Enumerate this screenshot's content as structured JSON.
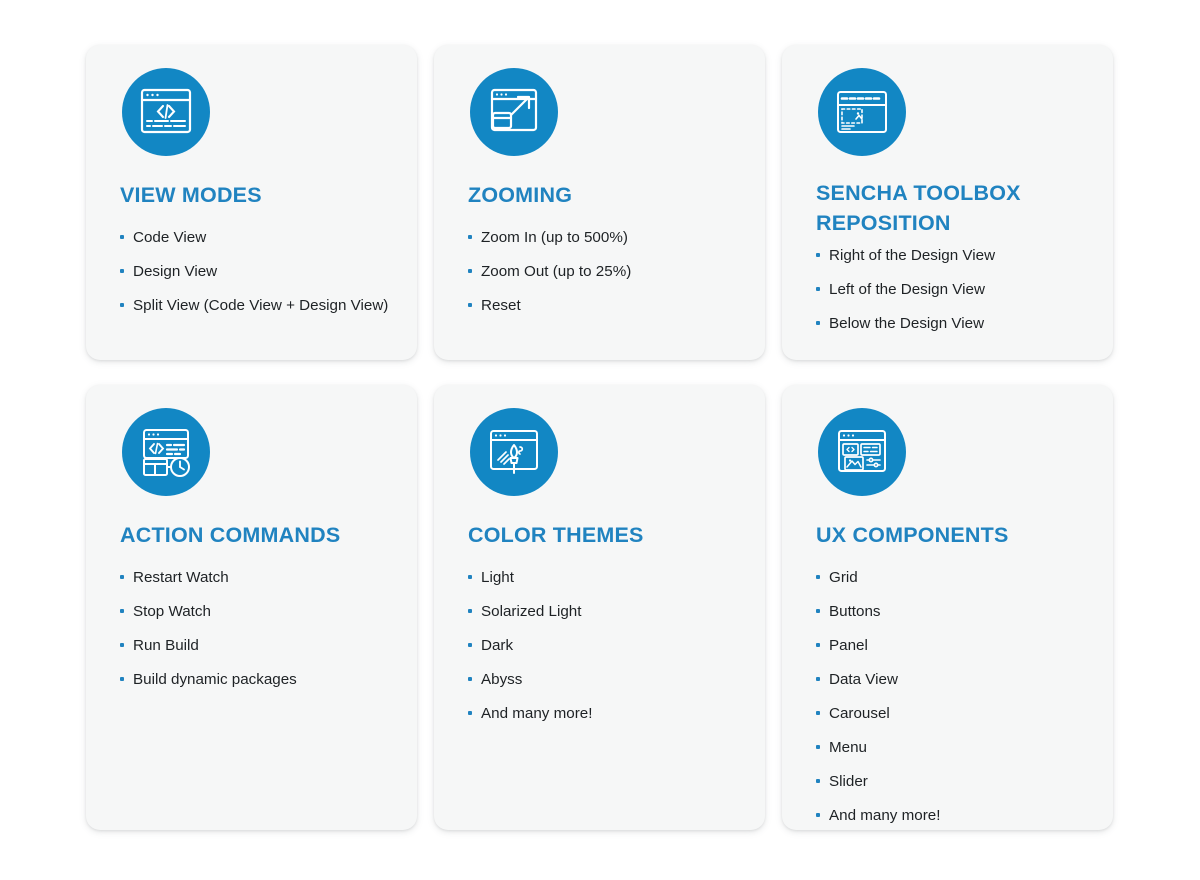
{
  "theme": {
    "page_background": "#ffffff",
    "card_background": "#f6f7f7",
    "icon_circle_color": "#1287c4",
    "title_color": "#2083c0",
    "bullet_color": "#2083c0",
    "body_text_color": "#1e2225"
  },
  "cards": [
    {
      "icon": "code-window-icon",
      "title": "VIEW MODES",
      "items": [
        "Code View",
        "Design View",
        "Split View (Code View + Design View)"
      ]
    },
    {
      "icon": "zoom-expand-window-icon",
      "title": "ZOOMING",
      "items": [
        "Zoom In (up to 500%)",
        "Zoom Out (up to 25%)",
        "Reset"
      ]
    },
    {
      "icon": "toolbox-window-icon",
      "title": "SENCHA TOOLBOX\nREPOSITION",
      "items": [
        "Right of the Design View",
        "Left of the Design View",
        "Below the Design View"
      ]
    },
    {
      "icon": "code-clock-window-icon",
      "title": "ACTION COMMANDS",
      "items": [
        "Restart Watch",
        "Stop Watch",
        "Run Build",
        "Build dynamic packages"
      ]
    },
    {
      "icon": "paintbrush-window-icon",
      "title": "COLOR THEMES",
      "items": [
        "Light",
        "Solarized Light",
        "Dark",
        "Abyss",
        "And many more!"
      ]
    },
    {
      "icon": "components-window-icon",
      "title": "UX COMPONENTS",
      "items": [
        "Grid",
        "Buttons",
        "Panel",
        "Data View",
        "Carousel",
        "Menu",
        "Slider",
        "And many more!"
      ]
    }
  ]
}
